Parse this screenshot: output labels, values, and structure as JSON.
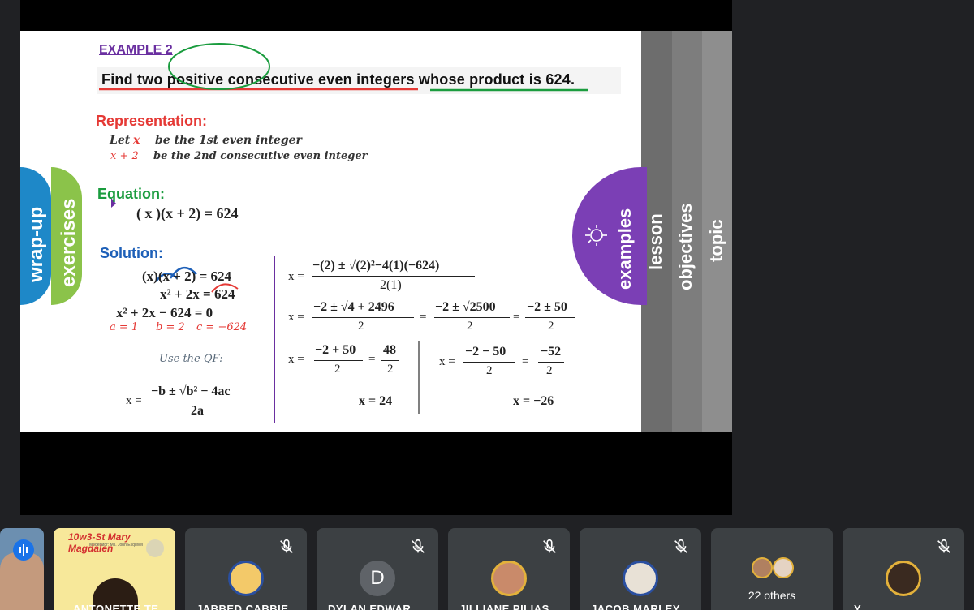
{
  "slide": {
    "example_label": "EXAMPLE 2",
    "problem": "Find two positive consecutive even integers whose product is 624.",
    "representation_heading": "Representation:",
    "rep_let": "Let",
    "rep_x": "x",
    "rep_line1_text": "be the 1st even integer",
    "rep_x2": "x + 2",
    "rep_line2_text": "be the 2nd consecutive even integer",
    "equation_heading": "Equation:",
    "equation": "( x )(x + 2) = 624",
    "solution_heading": "Solution:",
    "sol_line1": "(x)(x + 2) = 624",
    "sol_line2": "x² + 2x = 624",
    "sol_line3": "x² + 2x − 624 = 0",
    "coef_a": "a = 1",
    "coef_b": "b = 2",
    "coef_c": "c = −624",
    "use_qf": "Use the QF:",
    "qf_lhs": "x =",
    "qf_num": "−b ± √b² − 4ac",
    "qf_den": "2a",
    "step1_lhs": "x =",
    "step1_num": "−(2) ± √(2)²−4(1)(−624)",
    "step1_den": "2(1)",
    "step2_lhs": "x =",
    "step2_num_a": "−2 ± √4 + 2496",
    "step2_den_a": "2",
    "step2_num_b": "−2 ± √2500",
    "step2_den_b": "2",
    "step2_num_c": "−2 ± 50",
    "step2_den_c": "2",
    "eq_sign": "=",
    "step3_lhs": "x =",
    "step3_num_a": "−2 + 50",
    "step3_den_a": "2",
    "step3_num_b": "48",
    "step3_den_b": "2",
    "result_pos": "x = 24",
    "step4_lhs": "x =",
    "step4_num_a": "−2 − 50",
    "step4_den_a": "2",
    "step4_num_b": "−52",
    "step4_den_b": "2",
    "result_neg": "x = −26",
    "tabs": {
      "wrap_up": "wrap-up",
      "exercises": "exercises",
      "examples": "examples",
      "lesson": "lesson",
      "objectives": "objectives",
      "topic": "topic"
    }
  },
  "participants": {
    "tile2_header": "10w3-St Mary Magdalen",
    "tile2_sub": "Moderator: Ms. Jonh Esquivel",
    "tile2_name": "ANTONETTE TE...",
    "tile3_name": "JABBED CABBIE",
    "tile4_initial": "D",
    "tile4_name": "DYLAN EDWAR...",
    "tile5_name": "JILLIANE PILIAS",
    "tile6_name": "JACOB MARLEY",
    "tile7_others": "22 others",
    "tile8_name": "Y"
  },
  "colors": {
    "wrap_up": "#1e88c8",
    "exercises": "#8bc34a",
    "examples": "#7b3fb5",
    "lesson": "#6d6d6d",
    "objectives": "#7d7d7d",
    "topic": "#8e8e8e",
    "red": "#e53935",
    "green": "#1a9c3e",
    "purple_line": "#6a2fa0"
  }
}
